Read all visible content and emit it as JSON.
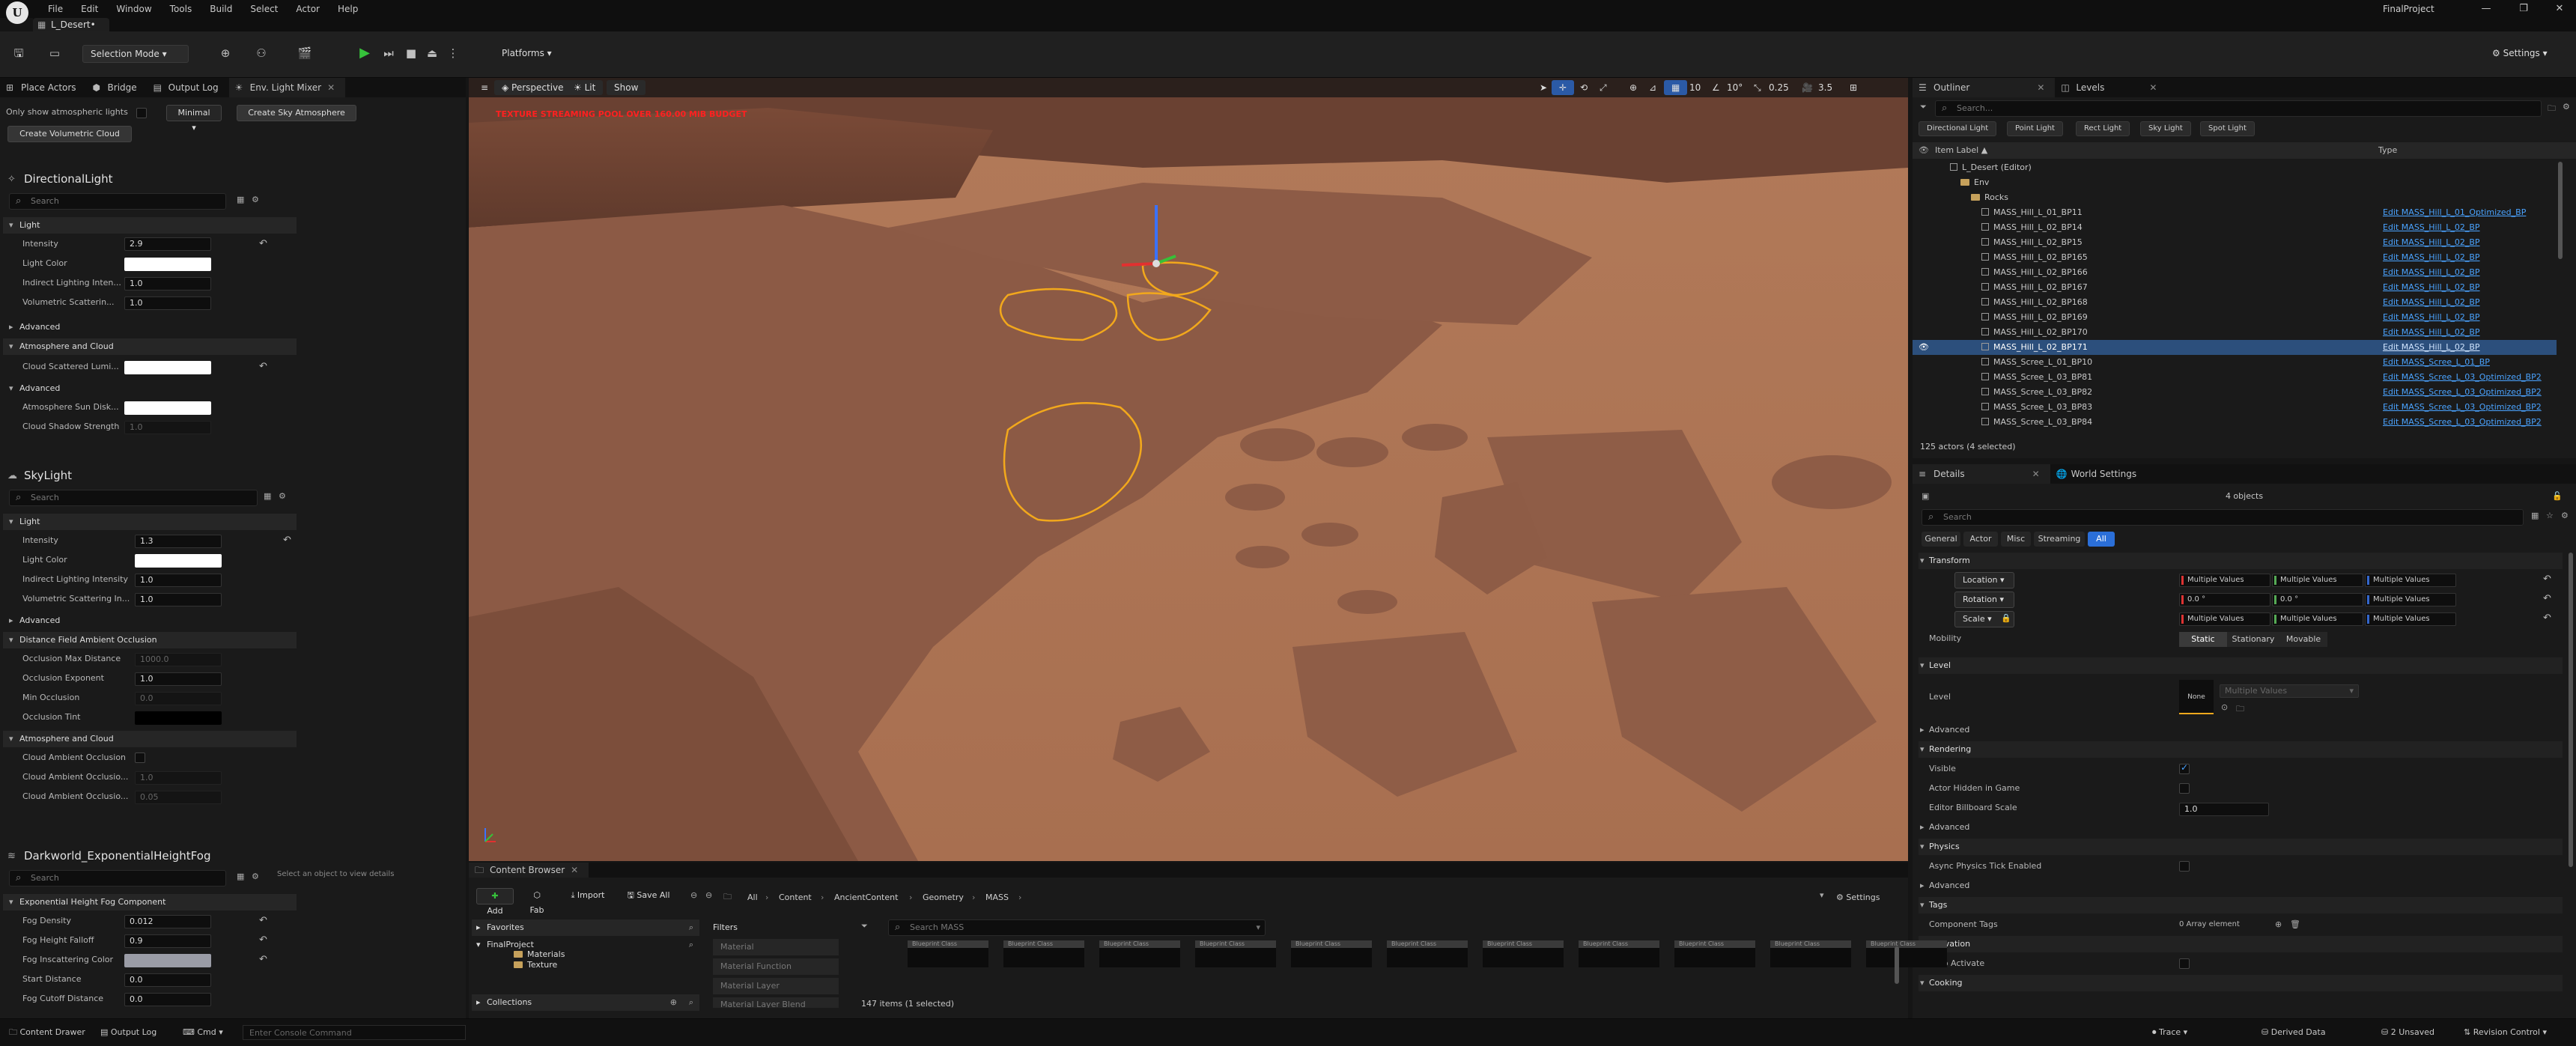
{
  "window": {
    "project_title": "FinalProject",
    "level_tab": "L_Desert•",
    "menu": [
      "File",
      "Edit",
      "Window",
      "Tools",
      "Build",
      "Select",
      "Actor",
      "Help"
    ],
    "logo_letter": "U"
  },
  "toolbar": {
    "selection_mode": "Selection Mode",
    "platforms": "Platforms",
    "settings": "Settings"
  },
  "left_panel": {
    "tabs": [
      "Place Actors",
      "Bridge",
      "Output Log",
      "Env. Light Mixer"
    ],
    "only_show_label": "Only show atmospheric lights",
    "minimal": "Minimal",
    "create_sky_btn": "Create Sky Atmosphere",
    "create_cloud_btn": "Create Volumetric Cloud",
    "search_placeholder": "Search",
    "select_hint": "Select an object to view details",
    "directional": {
      "title": "DirectionalLight",
      "cat_light": "Light",
      "intensity_label": "Intensity",
      "intensity": "2.9",
      "light_color_label": "Light Color",
      "indirect_label": "Indirect Lighting Inten...",
      "indirect": "1.0",
      "volumetric_label": "Volumetric Scatterin...",
      "volumetric": "1.0",
      "cat_advanced": "Advanced",
      "cat_atmo": "Atmosphere and Cloud",
      "cloud_scattered_label": "Cloud Scattered Lumi...",
      "cat_advanced2": "Advanced",
      "sun_disk_label": "Atmosphere Sun Disk...",
      "shadow_label": "Cloud Shadow Strength",
      "shadow": "1.0"
    },
    "skylight": {
      "title": "SkyLight",
      "cat_light": "Light",
      "intensity_label": "Intensity",
      "intensity": "1.3",
      "light_color_label": "Light Color",
      "indirect_label": "Indirect Lighting Intensity",
      "indirect": "1.0",
      "volumetric_label": "Volumetric Scattering In...",
      "volumetric": "1.0",
      "cat_advanced": "Advanced",
      "cat_dfao": "Distance Field Ambient Occlusion",
      "occ_max_label": "Occlusion Max Distance",
      "occ_max": "1000.0",
      "occ_exp_label": "Occlusion Exponent",
      "occ_exp": "1.0",
      "min_occ_label": "Min Occlusion",
      "min_occ": "0.0",
      "occ_tint_label": "Occlusion Tint",
      "cat_atmo": "Atmosphere and Cloud",
      "cloud_ao_label": "Cloud Ambient Occlusion",
      "cloud_ao2_label": "Cloud Ambient Occlusio...",
      "cloud_ao2": "1.0",
      "cloud_ao3_label": "Cloud Ambient Occlusio...",
      "cloud_ao3": "0.05"
    },
    "fog": {
      "title": "Darkworld_ExponentialHeightFog",
      "cat": "Exponential Height Fog Component",
      "density_label": "Fog Density",
      "density": "0.012",
      "falloff_label": "Fog Height Falloff",
      "falloff": "0.9",
      "inscatter_label": "Fog Inscattering Color",
      "start_label": "Start Distance",
      "start": "0.0",
      "cutoff_label": "Fog Cutoff Distance",
      "cutoff": "0.0"
    }
  },
  "viewport": {
    "perspective": "Perspective",
    "lit": "Lit",
    "show": "Show",
    "grid": "10",
    "angle": "10°",
    "scale": "0.25",
    "cam": "3.5",
    "warning": "TEXTURE STREAMING POOL OVER 160.00 MiB BUDGET"
  },
  "outliner": {
    "tabs": [
      "Outliner",
      "Levels"
    ],
    "search_placeholder": "Search...",
    "filters": [
      "Directional Light",
      "Point Light",
      "Rect Light",
      "Sky Light",
      "Spot Light"
    ],
    "col_label": "Item Label ▲",
    "col_type": "Type",
    "rows": [
      {
        "name": "L_Desert (Editor)",
        "type": "",
        "kind": "level",
        "indent": 0
      },
      {
        "name": "Env",
        "type": "",
        "kind": "folder",
        "indent": 1
      },
      {
        "name": "Rocks",
        "type": "",
        "kind": "folder",
        "indent": 2
      },
      {
        "name": "MASS_Hill_L_01_BP11",
        "type": "Edit MASS_Hill_L_01_Optimized_BP",
        "kind": "actor",
        "indent": 3
      },
      {
        "name": "MASS_Hill_L_02_BP14",
        "type": "Edit MASS_Hill_L_02_BP",
        "kind": "actor",
        "indent": 3
      },
      {
        "name": "MASS_Hill_L_02_BP15",
        "type": "Edit MASS_Hill_L_02_BP",
        "kind": "actor",
        "indent": 3
      },
      {
        "name": "MASS_Hill_L_02_BP165",
        "type": "Edit MASS_Hill_L_02_BP",
        "kind": "actor",
        "indent": 3
      },
      {
        "name": "MASS_Hill_L_02_BP166",
        "type": "Edit MASS_Hill_L_02_BP",
        "kind": "actor",
        "indent": 3
      },
      {
        "name": "MASS_Hill_L_02_BP167",
        "type": "Edit MASS_Hill_L_02_BP",
        "kind": "actor",
        "indent": 3
      },
      {
        "name": "MASS_Hill_L_02_BP168",
        "type": "Edit MASS_Hill_L_02_BP",
        "kind": "actor",
        "indent": 3
      },
      {
        "name": "MASS_Hill_L_02_BP169",
        "type": "Edit MASS_Hill_L_02_BP",
        "kind": "actor",
        "indent": 3
      },
      {
        "name": "MASS_Hill_L_02_BP170",
        "type": "Edit MASS_Hill_L_02_BP",
        "kind": "actor",
        "indent": 3
      },
      {
        "name": "MASS_Hill_L_02_BP171",
        "type": "Edit MASS_Hill_L_02_BP",
        "kind": "actor",
        "indent": 3,
        "selected": true
      },
      {
        "name": "MASS_Scree_L_01_BP10",
        "type": "Edit MASS_Scree_L_01_BP",
        "kind": "actor",
        "indent": 3
      },
      {
        "name": "MASS_Scree_L_03_BP81",
        "type": "Edit MASS_Scree_L_03_Optimized_BP2",
        "kind": "actor",
        "indent": 3
      },
      {
        "name": "MASS_Scree_L_03_BP82",
        "type": "Edit MASS_Scree_L_03_Optimized_BP2",
        "kind": "actor",
        "indent": 3
      },
      {
        "name": "MASS_Scree_L_03_BP83",
        "type": "Edit MASS_Scree_L_03_Optimized_BP2",
        "kind": "actor",
        "indent": 3
      },
      {
        "name": "MASS_Scree_L_03_BP84",
        "type": "Edit MASS_Scree_L_03_Optimized_BP2",
        "kind": "actor",
        "indent": 3
      }
    ],
    "status": "125 actors (4 selected)"
  },
  "details": {
    "tabs": [
      "Details",
      "World Settings"
    ],
    "objects": "4 objects",
    "search_placeholder": "Search",
    "filter_tabs": [
      "General",
      "Actor",
      "Misc",
      "Streaming",
      "All"
    ],
    "transform": "Transform",
    "location": "Location",
    "rotation": "Rotation",
    "scale": "Scale",
    "multiple": "Multiple Values",
    "zero": "0.0 °",
    "mobility": "Mobility",
    "mobility_opts": [
      "Static",
      "Stationary",
      "Movable"
    ],
    "level_cat": "Level",
    "level_label": "Level",
    "level_none": "None",
    "advanced": "Advanced",
    "rendering": "Rendering",
    "visible": "Visible",
    "hidden_in_game": "Actor Hidden in Game",
    "billboard": "Editor Billboard Scale",
    "billboard_val": "1.0",
    "physics": "Physics",
    "async_physics": "Async Physics Tick Enabled",
    "tags": "Tags",
    "component_tags": "Component Tags",
    "array_elem": "0 Array element",
    "activation": "Activation",
    "auto_activate": "Auto Activate",
    "cooking": "Cooking"
  },
  "content_browser": {
    "tab": "Content Browser",
    "add": "Add",
    "fab": "Fab",
    "import": "Import",
    "save_all": "Save All",
    "crumbs": [
      "All",
      "Content",
      "AncientContent",
      "Geometry",
      "MASS"
    ],
    "settings": "Settings",
    "favorites": "Favorites",
    "project": "FinalProject",
    "folders": [
      "Materials",
      "Texture"
    ],
    "collections": "Collections",
    "filters_title": "Filters",
    "filter_items": [
      "Material",
      "Material Function",
      "Material Layer",
      "Material Layer Blend"
    ],
    "search_placeholder": "Search MASS",
    "thumb_label": "Blueprint Class",
    "status": "147 items (1 selected)"
  },
  "statusbar": {
    "content_drawer": "Content Drawer",
    "output_log": "Output Log",
    "cmd": "Cmd",
    "console_placeholder": "Enter Console Command",
    "trace": "Trace",
    "derived": "Derived Data",
    "unsaved": "2 Unsaved",
    "revision": "Revision Control"
  }
}
